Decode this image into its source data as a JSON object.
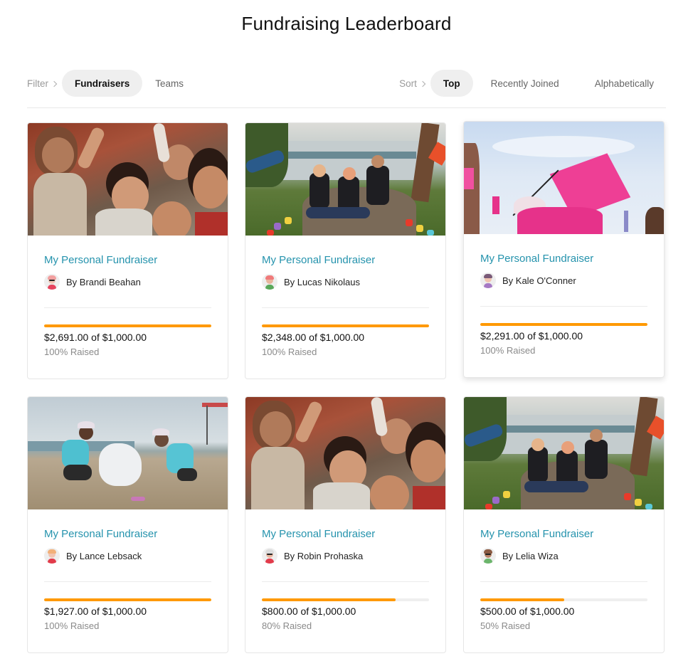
{
  "page": {
    "title": "Fundraising Leaderboard"
  },
  "filter": {
    "label": "Filter",
    "options": [
      {
        "label": "Fundraisers",
        "active": true
      },
      {
        "label": "Teams",
        "active": false
      }
    ]
  },
  "sort": {
    "label": "Sort",
    "options": [
      {
        "label": "Top",
        "active": true
      },
      {
        "label": "Recently Joined",
        "active": false
      },
      {
        "label": "Alphabetically",
        "active": false
      }
    ]
  },
  "colors": {
    "accent": "#2593ad",
    "progress": "#ff9900",
    "progress_track": "#efefef"
  },
  "cards": [
    {
      "title": "My Personal Fundraiser",
      "owner": "By Brandi Beahan",
      "image": "children-smiling-photo",
      "amount": "$2,691.00 of $1,000.00",
      "raised": "100% Raised",
      "progress_percent": 100,
      "hovered": false,
      "avatar": {
        "hair": "#f2a0a0",
        "face": "#f3c6b4",
        "shirt": "#e6435d",
        "glasses": true
      }
    },
    {
      "title": "My Personal Fundraiser",
      "owner": "By Lucas Nikolaus",
      "image": "volunteers-park-photo",
      "amount": "$2,348.00 of $1,000.00",
      "raised": "100% Raised",
      "progress_percent": 100,
      "hovered": false,
      "avatar": {
        "hair": "#f07a7a",
        "face": "#e9b59d",
        "shirt": "#5aa85a",
        "glasses": false
      }
    },
    {
      "title": "My Personal Fundraiser",
      "owner": "By Kale O'Conner",
      "image": "pink-flag-rally-photo",
      "amount": "$2,291.00 of $1,000.00",
      "raised": "100% Raised",
      "progress_percent": 100,
      "hovered": true,
      "avatar": {
        "hair": "#7a5a78",
        "face": "#f0c3b0",
        "shirt": "#a679c4",
        "glasses": false
      }
    },
    {
      "title": "My Personal Fundraiser",
      "owner": "By Lance Lebsack",
      "image": "beach-cleanup-photo",
      "amount": "$1,927.00 of $1,000.00",
      "raised": "100% Raised",
      "progress_percent": 100,
      "hovered": false,
      "avatar": {
        "hair": "#f2b07a",
        "face": "#f2c4b0",
        "shirt": "#e23b4a",
        "glasses": false
      }
    },
    {
      "title": "My Personal Fundraiser",
      "owner": "By Robin Prohaska",
      "image": "children-smiling-photo",
      "amount": "$800.00 of $1,000.00",
      "raised": "80% Raised",
      "progress_percent": 80,
      "hovered": false,
      "avatar": {
        "hair": "#dcdcdc",
        "face": "#eab7a0",
        "shirt": "#e23b4a",
        "glasses": true
      }
    },
    {
      "title": "My Personal Fundraiser",
      "owner": "By Lelia Wiza",
      "image": "volunteers-park-photo",
      "amount": "$500.00 of $1,000.00",
      "raised": "50% Raised",
      "progress_percent": 50,
      "hovered": false,
      "avatar": {
        "hair": "#8a5a42",
        "face": "#b98266",
        "shirt": "#6bb56b",
        "glasses": true
      }
    }
  ]
}
